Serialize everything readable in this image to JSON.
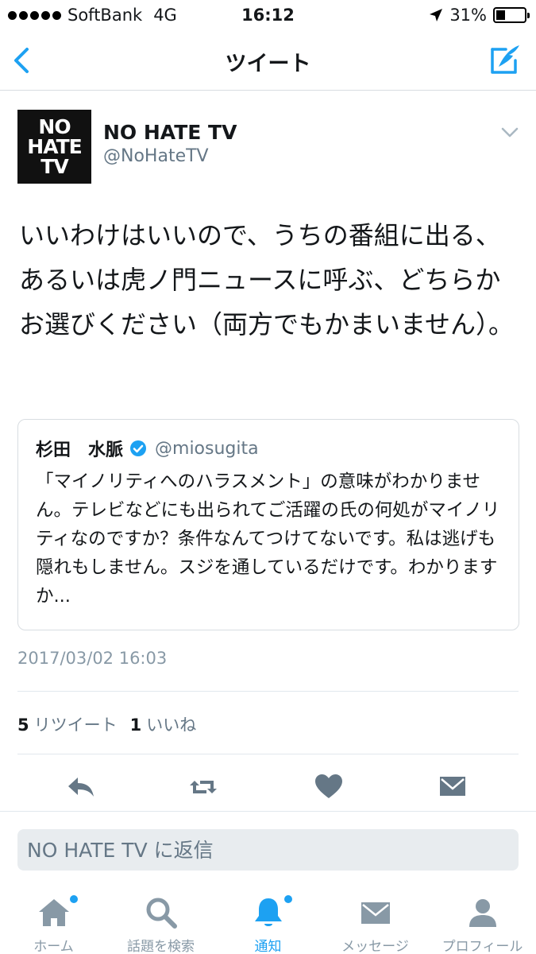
{
  "status_bar": {
    "carrier": "SoftBank",
    "network": "4G",
    "time": "16:12",
    "battery_text": "31%",
    "battery_level": 0.31
  },
  "nav": {
    "title": "ツイート",
    "back_icon": "chevron-left-icon",
    "compose_icon": "compose-tweet-icon",
    "accent_color": "#1da1f2"
  },
  "tweet": {
    "avatar_lines": [
      "NO",
      "HATE",
      "TV"
    ],
    "display_name": "NO HATE TV",
    "handle": "@NoHateTV",
    "text": "いいわけはいいので、うちの番組に出る、あるいは虎ノ門ニュースに呼ぶ、どちらかお選びください（両方でもかまいません）。",
    "timestamp": "2017/03/02 16:03",
    "retweet_count": "5",
    "retweet_label": "リツイート",
    "like_count": "1",
    "like_label": "いいね"
  },
  "quote": {
    "name": "杉田　水脈",
    "verified": true,
    "handle": "@miosugita",
    "text": "「マイノリティへのハラスメント」の意味がわかりません。テレビなどにも出られてご活躍の氏の何処がマイノリティなのですか？条件なんてつけてないです。私は逃げも隠れもしません。スジを通しているだけです。わかりますか..."
  },
  "reply": {
    "placeholder": "NO HATE TV に返信"
  },
  "tabs": [
    {
      "label": "ホーム",
      "icon": "home-icon",
      "badge": true,
      "active": false
    },
    {
      "label": "話題を検索",
      "icon": "search-icon",
      "badge": false,
      "active": false
    },
    {
      "label": "通知",
      "icon": "bell-icon",
      "badge": true,
      "active": true
    },
    {
      "label": "メッセージ",
      "icon": "envelope-icon",
      "badge": false,
      "active": false
    },
    {
      "label": "プロフィール",
      "icon": "person-icon",
      "badge": false,
      "active": false
    }
  ]
}
